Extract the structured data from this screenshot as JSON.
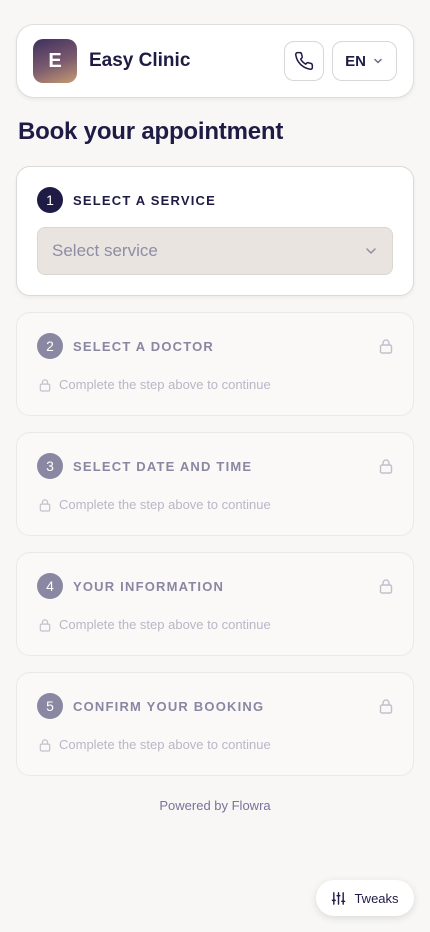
{
  "header": {
    "logo_letter": "E",
    "clinic_name": "Easy Clinic",
    "language": "EN"
  },
  "page_title": "Book your appointment",
  "steps": [
    {
      "number": "1",
      "label": "SELECT A SERVICE",
      "state": "active",
      "select_placeholder": "Select service"
    },
    {
      "number": "2",
      "label": "SELECT A DOCTOR",
      "state": "locked",
      "hint": "Complete the step above to continue"
    },
    {
      "number": "3",
      "label": "SELECT DATE AND TIME",
      "state": "locked",
      "hint": "Complete the step above to continue"
    },
    {
      "number": "4",
      "label": "YOUR INFORMATION",
      "state": "locked",
      "hint": "Complete the step above to continue"
    },
    {
      "number": "5",
      "label": "CONFIRM YOUR BOOKING",
      "state": "locked",
      "hint": "Complete the step above to continue"
    }
  ],
  "footer": {
    "powered_by": "Powered by Flowra"
  },
  "tweaks": {
    "label": "Tweaks"
  },
  "icons": {
    "phone": "phone-icon",
    "lang_chevron": "chevron-down-icon",
    "select_chevron": "chevron-down-icon",
    "lock": "lock-icon",
    "tweaks": "sliders-icon"
  },
  "colors": {
    "primary": "#1e1b45",
    "muted": "#8a87a2",
    "background": "#f8f7f5",
    "select_bg": "#e9e4df"
  }
}
